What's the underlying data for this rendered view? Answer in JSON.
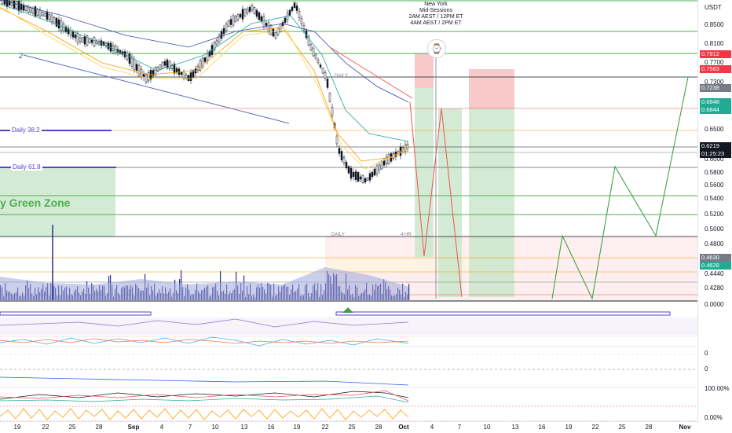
{
  "axis": {
    "currency": "USDT",
    "ticks": [
      "0.8500",
      "0.8100",
      "0.7700",
      "0.7300",
      "0.6500",
      "0.6000",
      "0.5800",
      "0.5600",
      "0.5400",
      "0.5200",
      "0.5000",
      "0.4800",
      "0.4440",
      "0.4280",
      "0.0000",
      "0",
      "0",
      "100.00%",
      "0.00%"
    ],
    "badges": [
      {
        "text": "0.7912",
        "color": "#f23645"
      },
      {
        "text": "0.7583",
        "color": "#f23645"
      },
      {
        "text": "0.7238",
        "color": "#787b86"
      },
      {
        "text": "0.6848",
        "color": "#22ab94"
      },
      {
        "text": "0.6844",
        "color": "#22ab94"
      },
      {
        "text": "0.6219",
        "color": "#131722"
      },
      {
        "text": "01:25:23",
        "color": "#131722"
      },
      {
        "text": "0.4630",
        "color": "#787b86"
      },
      {
        "text": "0.4628",
        "color": "#22ab94"
      }
    ]
  },
  "time_axis": [
    "19",
    "22",
    "25",
    "28",
    "Sep",
    "4",
    "7",
    "10",
    "13",
    "16",
    "19",
    "22",
    "25",
    "28",
    "Oct",
    "4",
    "7",
    "10",
    "13",
    "16",
    "19",
    "22",
    "25",
    "28",
    "Nov"
  ],
  "annotations": {
    "session_box": [
      "New York",
      "Mid-Sessions",
      "2AM AEST / 12PM ET",
      "4AM AEST / 2PM ET"
    ],
    "daily_38": "Daily 38.2",
    "daily_61": "Daily 61.8",
    "green_zone": "y Green Zone",
    "daily_upper": "DAILY",
    "daily_lower": "DAILY",
    "four_hr": "4 HR",
    "wave_label": "2"
  },
  "colors": {
    "bull": "#22ab94",
    "bear": "#f23645",
    "volume": "#2a2e8c",
    "green_zone": "#4caf50",
    "fib_line": "#5b3fc7"
  }
}
